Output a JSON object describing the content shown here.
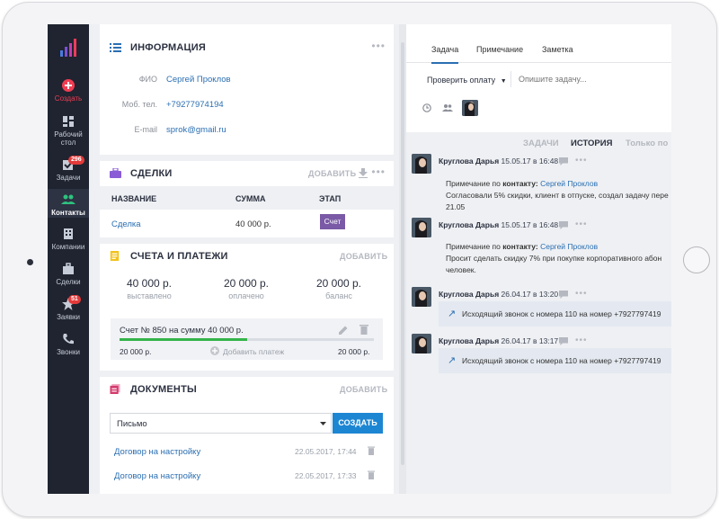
{
  "sidebar": {
    "items": [
      {
        "label_lines": [
          "Создать"
        ],
        "icon": "plus-circle-icon",
        "badge": ""
      },
      {
        "label_lines": [
          "Рабочий",
          "стол"
        ],
        "icon": "dashboard-icon",
        "badge": ""
      },
      {
        "label_lines": [
          "Задачи"
        ],
        "icon": "checkbox-icon",
        "badge": "296"
      },
      {
        "label_lines": [
          "Контакты"
        ],
        "icon": "people-icon",
        "badge": ""
      },
      {
        "label_lines": [
          "Компании"
        ],
        "icon": "building-icon",
        "badge": ""
      },
      {
        "label_lines": [
          "Сделки"
        ],
        "icon": "briefcase-icon",
        "badge": ""
      },
      {
        "label_lines": [
          "Заявки"
        ],
        "icon": "star-icon",
        "badge": "51"
      },
      {
        "label_lines": [
          "Звонки"
        ],
        "icon": "phone-icon",
        "badge": ""
      }
    ]
  },
  "info": {
    "title": "ИНФОРМАЦИЯ",
    "fields": [
      {
        "label": "ФИО",
        "value": "Сергей Проклов"
      },
      {
        "label": "Моб. тел.",
        "value": "+79277974194"
      },
      {
        "label": "E-mail",
        "value": "sprok@gmail.ru"
      }
    ]
  },
  "deals": {
    "title": "СДЕЛКИ",
    "add": "ДОБАВИТЬ",
    "columns": [
      "НАЗВАНИЕ",
      "СУММА",
      "ЭТАП"
    ],
    "rows": [
      {
        "name": "Сделка",
        "sum": "40 000 р.",
        "stage": "Счет"
      }
    ]
  },
  "payments": {
    "title": "СЧЕТА И ПЛАТЕЖИ",
    "add": "ДОБАВИТЬ",
    "stats": [
      {
        "value": "40 000 р.",
        "caption": "выставлено"
      },
      {
        "value": "20 000 р.",
        "caption": "оплачено"
      },
      {
        "value": "20 000 р.",
        "caption": "баланс"
      }
    ],
    "invoice": {
      "title": "Счет № 850 на сумму 40 000 р.",
      "paid": "20 000 р.",
      "add_payment": "Добавить платеж",
      "balance": "20 000 р.",
      "progress": 0.5
    }
  },
  "documents": {
    "title": "ДОКУМЕНТЫ",
    "add": "ДОБАВИТЬ",
    "select_value": "Письмо",
    "create": "СОЗДАТЬ",
    "items": [
      {
        "name": "Договор на настройку",
        "date": "22.05.2017, 17:44"
      },
      {
        "name": "Договор на настройку",
        "date": "22.05.2017, 17:33"
      }
    ]
  },
  "task": {
    "tabs": [
      "Задача",
      "Примечание",
      "Заметка"
    ],
    "action": "Проверить оплату",
    "placeholder": "Опишите задачу..."
  },
  "history": {
    "tabs": [
      "ЗАДАЧИ",
      "ИСТОРИЯ",
      "Только по"
    ],
    "items": [
      {
        "author": "Круглова Дарья",
        "when": "15.05.17 в 16:48",
        "prefix": "Примечание по ",
        "ref_label": "контакту:",
        "contact": "Сергей Проклов",
        "lines": [
          "Согласовали 5% скидки, клиент в отпуске, создал задачу пере",
          "21.05"
        ]
      },
      {
        "author": "Круглова Дарья",
        "when": "15.05.17 в 16:48",
        "prefix": "Примечание по ",
        "ref_label": "контакту:",
        "contact": "Сергей Проклов",
        "lines": [
          "Просит сделать скидку 7% при покупке корпоративного абон",
          "человек."
        ]
      },
      {
        "author": "Круглова Дарья",
        "when": "26.04.17 в 13:20",
        "call": "Исходящий звонок с номера 110 на номер +7927797419"
      },
      {
        "author": "Круглова Дарья",
        "when": "26.04.17 в 13:17",
        "call": "Исходящий звонок с номера 110 на номер +7927797419"
      }
    ]
  }
}
